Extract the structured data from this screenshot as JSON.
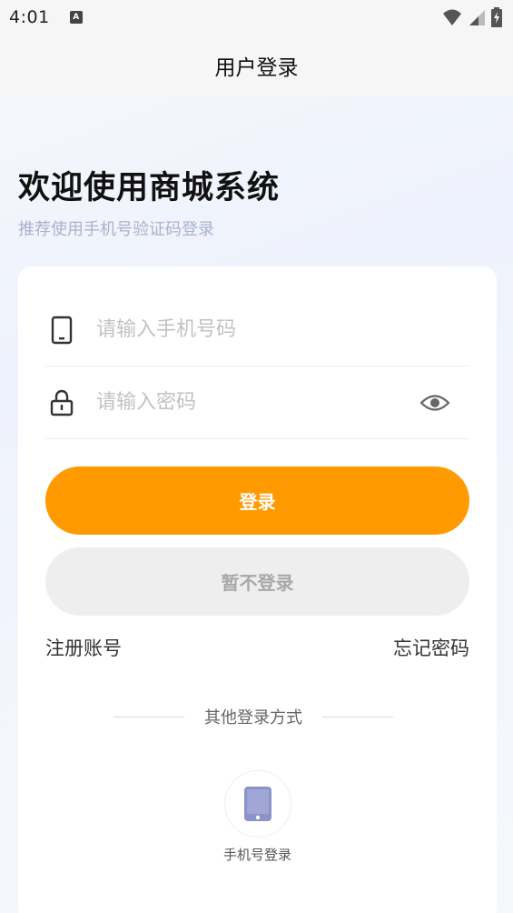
{
  "status_bar": {
    "time": "4:01",
    "notification_icon": "text-a-icon"
  },
  "app_bar": {
    "title": "用户登录"
  },
  "welcome": {
    "title": "欢迎使用商城系统",
    "subtitle": "推荐使用手机号验证码登录"
  },
  "form": {
    "phone_placeholder": "请输入手机号码",
    "phone_value": "",
    "password_placeholder": "请输入密码",
    "password_value": "",
    "login_label": "登录",
    "skip_label": "暂不登录",
    "register_label": "注册账号",
    "forgot_label": "忘记密码"
  },
  "other_login": {
    "divider_text": "其他登录方式",
    "methods": [
      {
        "label": "手机号登录",
        "icon": "phone-icon"
      }
    ]
  },
  "colors": {
    "accent": "#ff9a00",
    "secondary_button": "#eeeeee",
    "phone_icon": "#8b93c9"
  }
}
